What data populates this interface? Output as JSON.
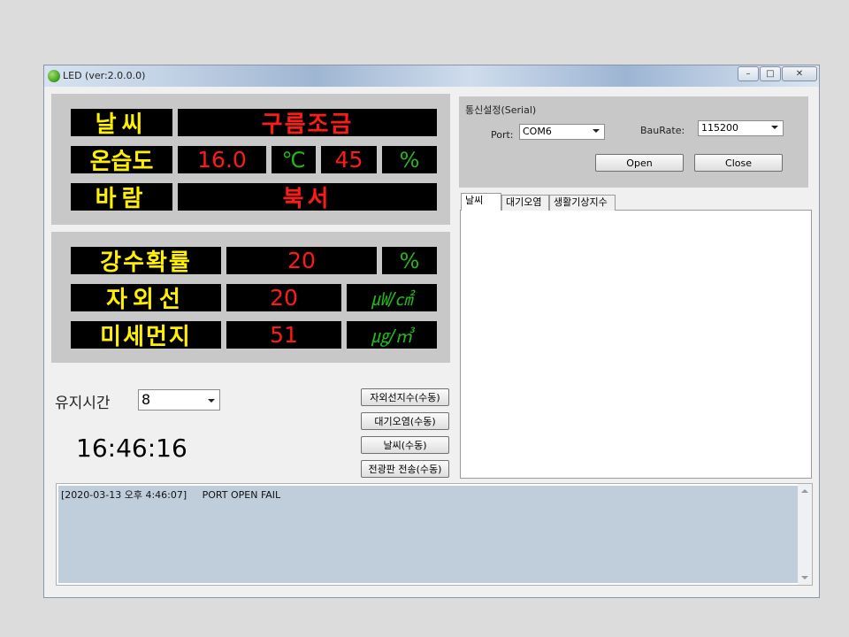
{
  "window": {
    "title": "LED (ver:2.0.0.0)"
  },
  "board1": {
    "weather_label": "날씨",
    "weather_value": "구름조금",
    "temp_hum_label": "온습도",
    "temp_value": "16.0",
    "temp_unit": "℃",
    "humidity_value": "45",
    "humidity_unit": "%",
    "wind_label": "바람",
    "wind_value": "북서"
  },
  "board2": {
    "precip_label": "강수확률",
    "precip_value": "20",
    "precip_unit": "%",
    "uv_label": "자외선",
    "uv_value": "20",
    "uv_unit": "㎼/㎠",
    "dust_label": "미세먼지",
    "dust_value": "51",
    "dust_unit": "㎍/㎥"
  },
  "hold": {
    "label": "유지시간",
    "value": "8"
  },
  "clock": "16:46:16",
  "manual_buttons": {
    "uv": "자외선지수(수동)",
    "air": "대기오염(수동)",
    "weather": "날씨(수동)",
    "send": "전광판 전송(수동)"
  },
  "serial": {
    "group_title": "통신설정(Serial)",
    "port_label": "Port:",
    "port_value": "COM6",
    "baud_label": "BauRate:",
    "baud_value": "115200",
    "open_label": "Open",
    "close_label": "Close"
  },
  "tabs": [
    "날씨",
    "대기오염",
    "생활기상지수"
  ],
  "log": {
    "line": "[2020-03-13 오후 4:46:07]     PORT OPEN FAIL"
  },
  "colors": {
    "led_yellow": "#ffef00",
    "led_red": "#ff1a1a",
    "led_green": "#22b81a"
  }
}
